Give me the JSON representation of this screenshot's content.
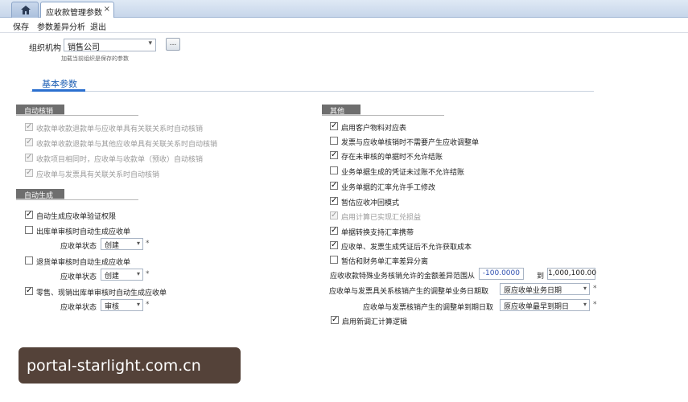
{
  "tabs": {
    "home_icon": "home-icon",
    "active_label": "应收款管理参数",
    "close_glyph": "×"
  },
  "menu": [
    "保存",
    "参数差异分析",
    "退出"
  ],
  "org": {
    "label": "组织机构",
    "value": "销售公司",
    "dots": "...",
    "hint": "加载当前组织是保存的参数"
  },
  "section_tab": "基本参数",
  "left": {
    "auto_verify": {
      "title": "自动核销",
      "options": [
        {
          "label": "收款单收款退款单与应收单具有关联关系时自动核销",
          "checked": true,
          "disabled": true
        },
        {
          "label": "收款单收款退款单与其他应收单具有关联关系时自动核销",
          "checked": true,
          "disabled": true
        },
        {
          "label": "收款项目相同时，应收单与收款单（预收）自动核销",
          "checked": true,
          "disabled": true
        },
        {
          "label": "应收单与发票具有关联关系时自动核销",
          "checked": true,
          "disabled": true
        }
      ]
    },
    "auto_gen": {
      "title": "自动生成",
      "options": [
        {
          "label": "自动生成应收单验证权限",
          "checked": true
        },
        {
          "label": "出库单审核时自动生成应收单",
          "checked": false,
          "status_label": "应收单状态",
          "status_value": "创建"
        },
        {
          "label": "退货单审核时自动生成应收单",
          "checked": false,
          "status_label": "应收单状态",
          "status_value": "创建"
        },
        {
          "label": "零售、现销出库单审核时自动生成应收单",
          "checked": true,
          "status_label": "应收单状态",
          "status_value": "审核"
        }
      ]
    }
  },
  "right": {
    "title": "其他",
    "options": [
      {
        "label": "启用客户物料对应表",
        "checked": true
      },
      {
        "label": "发票与应收单核销时不需要产生应收调整单",
        "checked": false
      },
      {
        "label": "存在未审核的单据时不允许结账",
        "checked": true
      },
      {
        "label": "业务单据生成的凭证未过账不允许结账",
        "checked": false
      },
      {
        "label": "业务单据的汇率允许手工修改",
        "checked": true
      },
      {
        "label": "暂估应收冲回模式",
        "checked": true
      },
      {
        "label": "启用计算已实现汇兑损益",
        "checked": true,
        "disabled": true
      },
      {
        "label": "单据转换支持汇率携带",
        "checked": true
      },
      {
        "label": "应收单、发票生成凭证后不允许获取成本",
        "checked": true
      },
      {
        "label": "暂估和财务单汇率差异分离",
        "checked": false
      }
    ],
    "range": {
      "label": "应收收款特殊业务核销允许的金额差异范围从",
      "from": "-100.0000",
      "to_label": "到",
      "to": "1,000,100.00"
    },
    "date1": {
      "label": "应收单与发票具关系核销产生的调整单业务日期取",
      "value": "原应收单业务日期"
    },
    "date2": {
      "label": "应收单与发票核销产生的调整单到期日取",
      "value": "原应收单最早到期日"
    },
    "last": {
      "label": "启用新调汇计算逻辑",
      "checked": true
    }
  },
  "watermark": "portal-starlight.com.cn"
}
